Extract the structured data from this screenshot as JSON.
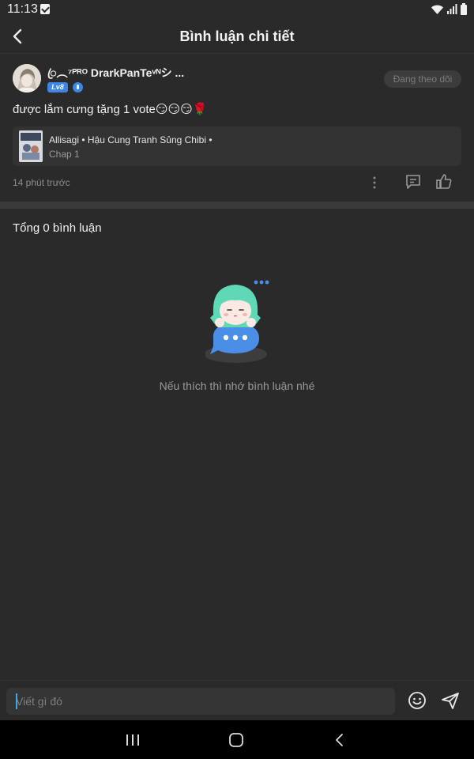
{
  "status_bar": {
    "time": "11:13",
    "icons": [
      "notification-check-icon",
      "wifi-icon",
      "signal-icon",
      "battery-icon"
    ]
  },
  "header": {
    "title": "Bình luận chi tiết",
    "back_icon": "chevron-left-icon"
  },
  "post": {
    "user_name": "ꦿ︵⁷ᴾᴿᴼ DrarkPanTeᵛᴺシ ...",
    "level": "Lv8",
    "follow_label": "Đang theo dõi",
    "comment": "được lắm cưng tặng 1 vote😏😏😏🌹",
    "manga": {
      "title": "Allisagi • Hậu Cung Tranh Sủng Chibi •",
      "chapter": "Chap 1"
    },
    "time_ago": "14 phút trước",
    "actions": [
      "more-vertical-icon",
      "reply-icon",
      "like-icon"
    ]
  },
  "comments": {
    "total_label": "Tổng 0 bình luận",
    "empty_message": "Nếu thích thì nhớ bình luận nhé"
  },
  "input": {
    "placeholder": "Viết gì đó"
  },
  "nav_bar": {
    "buttons": [
      "recents-icon",
      "home-icon",
      "back-icon"
    ]
  },
  "colors": {
    "background": "#2a2a2b",
    "accent": "#3d86e3",
    "card": "#333334",
    "divider": "#3a3a3b",
    "mascot_hair": "#5fd9b5",
    "bubble": "#4b8ee8"
  }
}
